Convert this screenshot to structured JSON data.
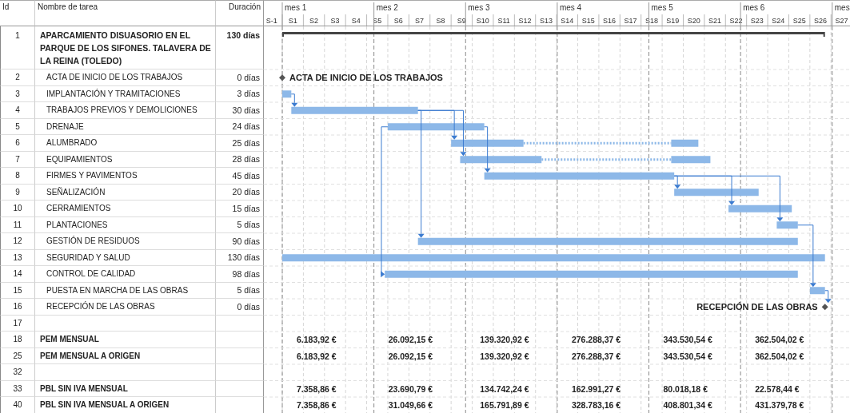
{
  "columns": {
    "id": "Id",
    "name": "Nombre de tarea",
    "duration": "Duración"
  },
  "timescale": {
    "months": [
      "mes 1",
      "mes 2",
      "mes 3",
      "mes 4",
      "mes 5",
      "mes 6",
      "mes"
    ],
    "weeks": [
      "S-1",
      "S1",
      "S2",
      "S3",
      "S4",
      "S5",
      "S6",
      "S7",
      "S8",
      "S9",
      "S10",
      "S11",
      "S12",
      "S13",
      "S14",
      "S15",
      "S16",
      "S17",
      "S18",
      "S19",
      "S20",
      "S21",
      "S22",
      "S23",
      "S24",
      "S25",
      "S26",
      "S27"
    ]
  },
  "rows": [
    {
      "id": "1",
      "name": "APARCAMIENTO DISUASORIO EN EL PARQUE DE LOS SIFONES. TALAVERA DE LA REINA (TOLEDO)",
      "duration": "130 días",
      "kind": "summary"
    },
    {
      "id": "2",
      "name": "ACTA DE INICIO DE LOS TRABAJOS",
      "duration": "0 días",
      "kind": "milestone",
      "label": "ACTA DE INICIO DE LOS TRABAJOS"
    },
    {
      "id": "3",
      "name": "IMPLANTACIÓN Y TRAMITACIONES",
      "duration": "3 días",
      "kind": "task"
    },
    {
      "id": "4",
      "name": "TRABAJOS PREVIOS Y DEMOLICIONES",
      "duration": "30 días",
      "kind": "task"
    },
    {
      "id": "5",
      "name": "DRENAJE",
      "duration": "24 días",
      "kind": "task"
    },
    {
      "id": "6",
      "name": "ALUMBRADO",
      "duration": "25 días",
      "kind": "task"
    },
    {
      "id": "7",
      "name": "EQUIPAMIENTOS",
      "duration": "28 días",
      "kind": "task"
    },
    {
      "id": "8",
      "name": "FIRMES Y PAVIMENTOS",
      "duration": "45 días",
      "kind": "task"
    },
    {
      "id": "9",
      "name": "SEÑALIZACIÓN",
      "duration": "20 días",
      "kind": "task"
    },
    {
      "id": "10",
      "name": "CERRAMIENTOS",
      "duration": "15 días",
      "kind": "task"
    },
    {
      "id": "11",
      "name": "PLANTACIONES",
      "duration": "5 días",
      "kind": "task"
    },
    {
      "id": "12",
      "name": "GESTIÓN DE RESIDUOS",
      "duration": "90 días",
      "kind": "task"
    },
    {
      "id": "13",
      "name": "SEGURIDAD Y SALUD",
      "duration": "130 días",
      "kind": "task"
    },
    {
      "id": "14",
      "name": "CONTROL DE CALIDAD",
      "duration": "98 días",
      "kind": "task"
    },
    {
      "id": "15",
      "name": "PUESTA EN MARCHA DE LAS OBRAS",
      "duration": "5 días",
      "kind": "task"
    },
    {
      "id": "16",
      "name": "RECEPCIÓN DE LAS OBRAS",
      "duration": "0 días",
      "kind": "milestone",
      "label": "RECEPCIÓN DE LAS OBRAS"
    },
    {
      "id": "17",
      "kind": "blank"
    },
    {
      "id": "18",
      "name": "PEM MENSUAL",
      "kind": "totals",
      "values": [
        "6.183,92 €",
        "26.092,15 €",
        "139.320,92 €",
        "276.288,37 €",
        "343.530,54 €",
        "362.504,02 €"
      ]
    },
    {
      "id": "25",
      "name": "PEM MENSUAL A ORIGEN",
      "kind": "totals",
      "values": [
        "6.183,92 €",
        "26.092,15 €",
        "139.320,92 €",
        "276.288,37 €",
        "343.530,54 €",
        "362.504,02 €"
      ]
    },
    {
      "id": "32",
      "kind": "blank"
    },
    {
      "id": "33",
      "name": "PBL SIN IVA MENSUAL",
      "kind": "totals",
      "values": [
        "7.358,86 €",
        "23.690,79 €",
        "134.742,24 €",
        "162.991,27 €",
        "80.018,18 €",
        "22.578,44 €"
      ]
    },
    {
      "id": "40",
      "name": "PBL SIN IVA MENSUAL A ORIGEN",
      "kind": "totals",
      "values": [
        "7.358,86 €",
        "31.049,66 €",
        "165.791,89 €",
        "328.783,16 €",
        "408.801,34 €",
        "431.379,78 €"
      ]
    }
  ]
}
